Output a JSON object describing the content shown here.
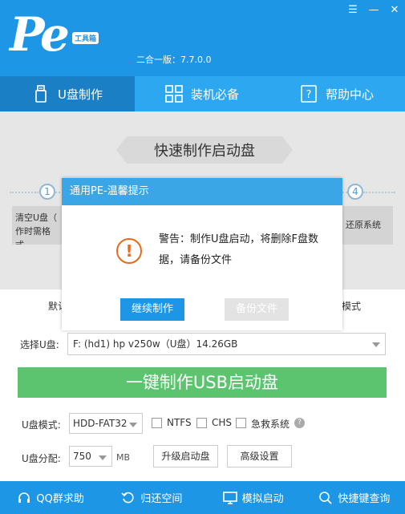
{
  "app": {
    "logo_text": "Pe",
    "logo_badge": "工具箱",
    "version": "二合一版：7.7.0.0"
  },
  "window": {
    "menu_glyph": "☰",
    "min_glyph": "—",
    "close_glyph": "✕"
  },
  "tabs": [
    {
      "label": "U盘制作",
      "icon": "usb-icon"
    },
    {
      "label": "装机必备",
      "icon": "grid-icon"
    },
    {
      "label": "帮助中心",
      "icon": "help-doc-icon"
    }
  ],
  "banner": {
    "title": "快速制作启动盘"
  },
  "steps": {
    "step1": {
      "number": "1",
      "text_line1": "清空U盘（",
      "text_line2": "作时需格式"
    },
    "step4": {
      "number": "4",
      "text": "还原系统"
    }
  },
  "mode_tabs": {
    "left": "默认",
    "right": "模式"
  },
  "dialog": {
    "title": "通用PE-温馨提示",
    "message": "警告：制作U盘启动，将删除F盘数据，请备份文件",
    "continue_label": "继续制作",
    "backup_label": "备份文件"
  },
  "select_udisk": {
    "label": "选择U盘:",
    "value": "F: (hd1) hp v250w（U盘）14.26GB"
  },
  "make_button": {
    "label": "一键制作USB启动盘"
  },
  "options": {
    "mode_label": "U盘模式:",
    "mode_value": "HDD-FAT32",
    "ntfs_label": "NTFS",
    "chs_label": "CHS",
    "rescue_label": "急救系统",
    "help_glyph": "?",
    "partition_label": "U盘分配:",
    "partition_value": "750",
    "partition_unit": "MB",
    "upgrade_label": "升级启动盘",
    "advanced_label": "高级设置"
  },
  "footer": [
    {
      "label": "QQ群求助",
      "icon": "headset-icon"
    },
    {
      "label": "归还空间",
      "icon": "restore-icon"
    },
    {
      "label": "模拟启动",
      "icon": "monitor-icon"
    },
    {
      "label": "快捷键查询",
      "icon": "search-icon"
    }
  ],
  "colors": {
    "primary_blue": "#1e96e6",
    "active_tab": "#1a7fc4",
    "green_button": "#5cc36f",
    "warning_orange": "#e86a1a"
  }
}
